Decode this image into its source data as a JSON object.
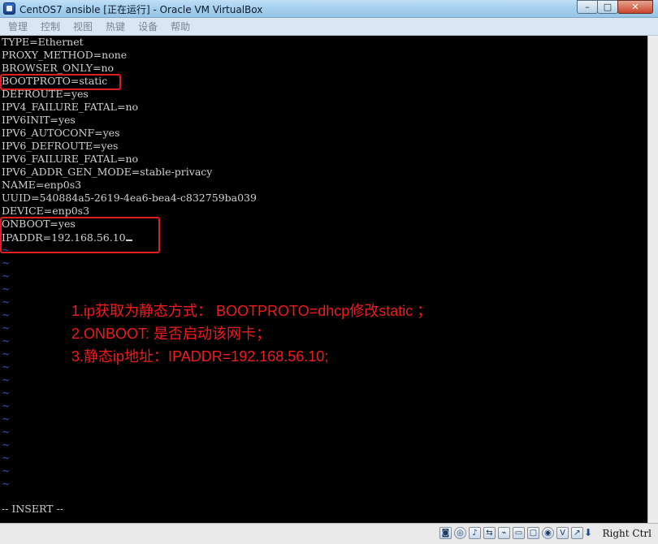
{
  "window": {
    "title": "CentOS7 ansible [正在运行] - Oracle VM VirtualBox",
    "minimize": "–",
    "maximize": "□",
    "close": "✕"
  },
  "menu": [
    "管理",
    "控制",
    "视图",
    "热键",
    "设备",
    "帮助"
  ],
  "terminal": {
    "lines": [
      "TYPE=Ethernet",
      "PROXY_METHOD=none",
      "BROWSER_ONLY=no",
      "BOOTPROTO=static",
      "DEFROUTE=yes",
      "IPV4_FAILURE_FATAL=no",
      "IPV6INIT=yes",
      "IPV6_AUTOCONF=yes",
      "IPV6_DEFROUTE=yes",
      "IPV6_FAILURE_FATAL=no",
      "IPV6_ADDR_GEN_MODE=stable-privacy",
      "NAME=enp0s3",
      "UUID=540884a5-2619-4ea6-bea4-c832759ba039",
      "DEVICE=enp0s3",
      "ONBOOT=yes",
      "IPADDR=192.168.56.10"
    ],
    "tilde": "~",
    "tilde_count": 19,
    "mode": "-- INSERT --"
  },
  "annotations": [
    "1.ip获取为静态方式： BOOTPROTO=dhcp修改static ；",
    "2.ONBOOT: 是否启动该网卡；",
    "3.静态ip地址：IPADDR=192.168.56.10;"
  ],
  "statusbar": {
    "host_key": "Right Ctrl",
    "icons": [
      "hard-disk-icon",
      "optical-drive-icon",
      "audio-icon",
      "network-icon",
      "usb-icon",
      "shared-folder-icon",
      "display-icon",
      "video-capture-icon",
      "virtualization-icon",
      "mouse-integration-icon"
    ]
  },
  "colors": {
    "highlight": "#e11d1d",
    "annotation": "#f11b1b",
    "tilde": "#3a5cc7",
    "terminal_text": "#d0d0d0"
  }
}
